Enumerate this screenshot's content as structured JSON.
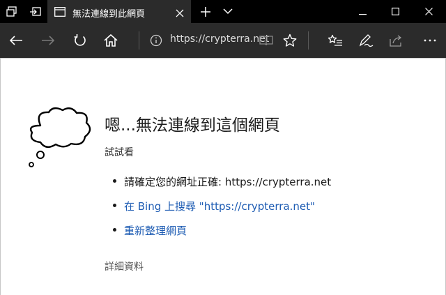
{
  "browser": {
    "tab_title": "無法連線到此網頁",
    "address": "https://crypterra.net",
    "icons": {
      "tab_preview": "tab-preview-icon",
      "set_aside": "set-aside-tabs-icon",
      "page": "page-icon",
      "close_tab": "close-icon",
      "new_tab": "plus-icon",
      "tab_menu": "chevron-down-icon",
      "back": "back-arrow-icon",
      "forward": "forward-arrow-icon",
      "refresh": "refresh-icon",
      "home": "home-icon",
      "info": "info-icon",
      "reading_view": "book-icon",
      "favorite": "star-icon",
      "favorites_hub": "favorites-list-icon",
      "notes": "pen-icon",
      "share": "share-icon"
    }
  },
  "window": {
    "minimize": "minimize-icon",
    "maximize": "maximize-icon",
    "close": "close-icon"
  },
  "error_page": {
    "heading": "嗯...無法連線到這個網頁",
    "subheading": "試試看",
    "items": [
      {
        "text": "請確定您的網址正確: https://crypterra.net",
        "link": false
      },
      {
        "text": "在 Bing 上搜尋 \"https://crypterra.net\"",
        "link": true
      },
      {
        "text": "重新整理網頁",
        "link": true
      }
    ],
    "details": "詳細資料",
    "colors": {
      "link": "#1e5cb3",
      "text": "#1a1a1a"
    }
  }
}
